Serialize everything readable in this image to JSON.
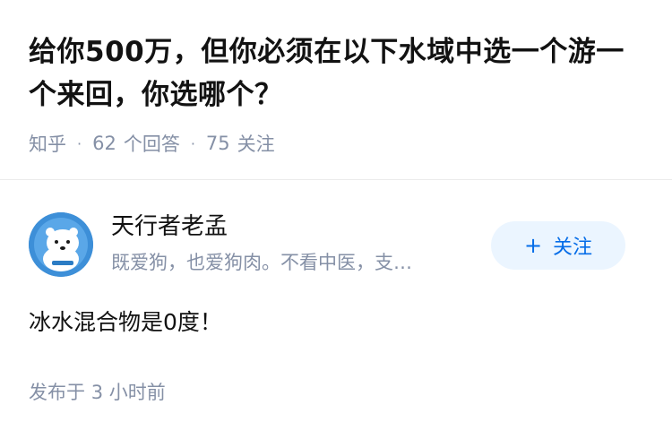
{
  "question": {
    "title": "给你500万，但你必须在以下水域中选一个游一个来回，你选哪个？",
    "source": "知乎",
    "answers_count": "62",
    "answers_label": "个回答",
    "followers_count": "75",
    "followers_label": "关注"
  },
  "author": {
    "name": "天行者老孟",
    "bio": "既爱狗，也爱狗肉。不看中医，支…",
    "avatar_icon": "polar-bear-avatar-icon",
    "follow_label": "关注",
    "follow_icon": "plus-icon"
  },
  "answer": {
    "content": "冰水混合物是0度！"
  },
  "meta": {
    "published_prefix": "发布于",
    "published_time": "3 小时前"
  },
  "colors": {
    "accent": "#056de8",
    "button_bg": "#ebf5ff",
    "muted_text": "#8590a6",
    "primary_text": "#121212",
    "avatar_bg": "#3d8fd8"
  }
}
